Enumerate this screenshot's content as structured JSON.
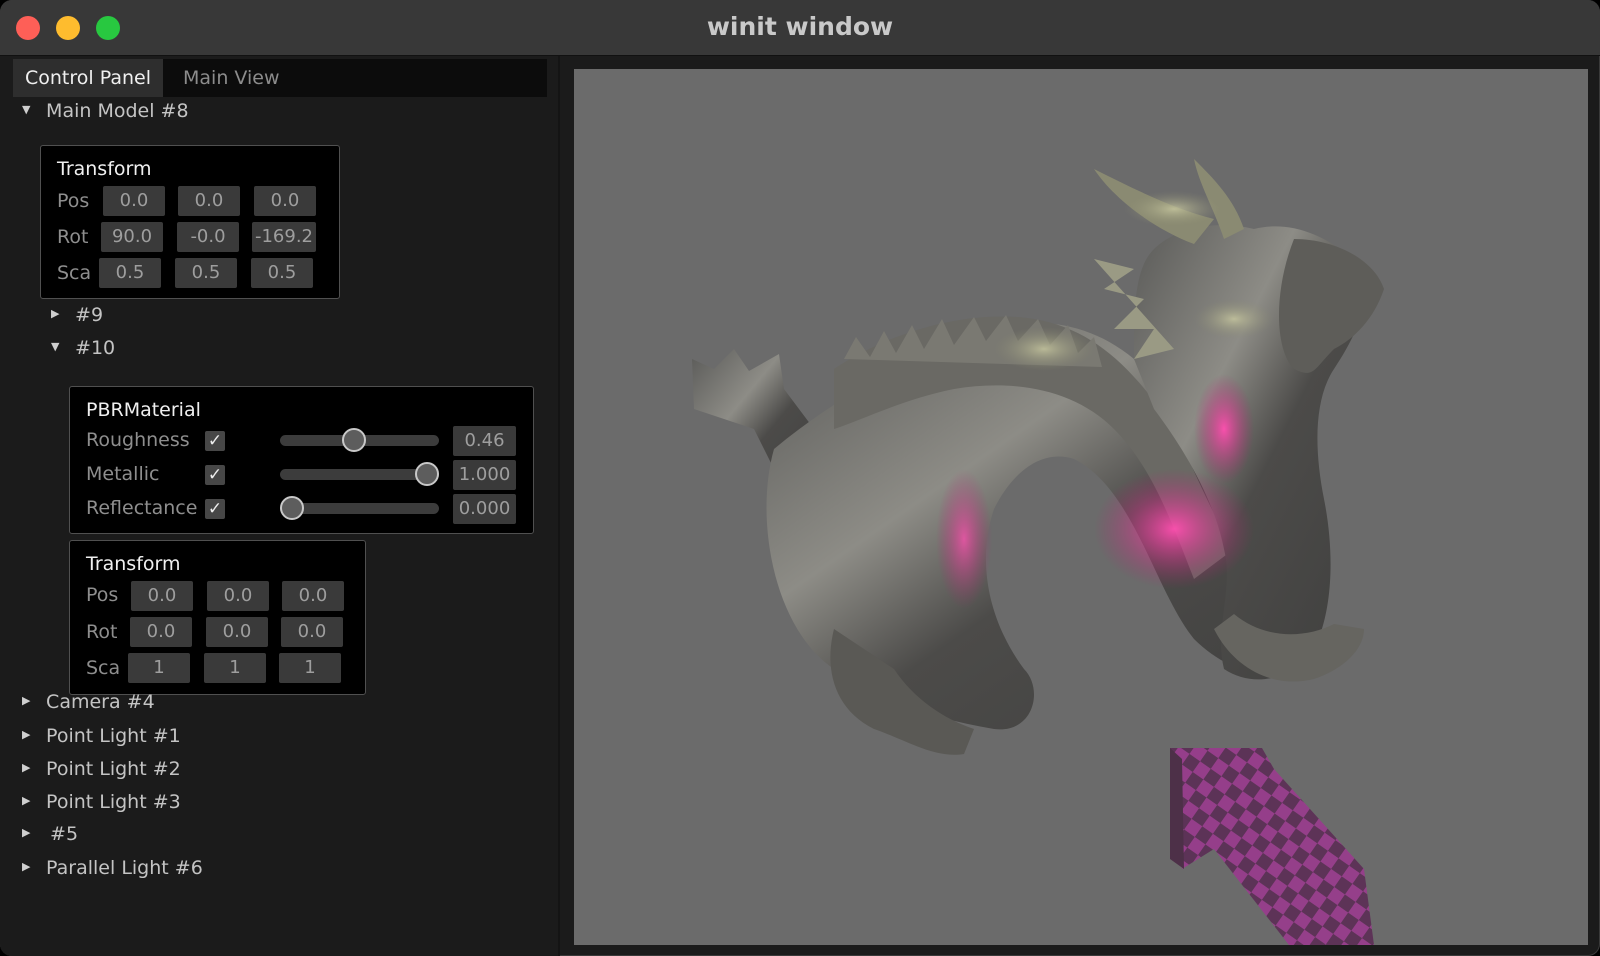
{
  "window": {
    "title": "winit window"
  },
  "tabs": [
    {
      "label": "Control Panel",
      "active": true
    },
    {
      "label": "Main View",
      "active": false
    }
  ],
  "tree": {
    "main_model": {
      "label": "Main Model #8",
      "expanded": true
    },
    "transform_top": {
      "title": "Transform",
      "pos_label": "Pos",
      "rot_label": "Rot",
      "sca_label": "Sca",
      "pos": [
        "0.0",
        "0.0",
        "0.0"
      ],
      "rot": [
        "90.0",
        "-0.0",
        "-169.2"
      ],
      "sca": [
        "0.5",
        "0.5",
        "0.5"
      ]
    },
    "child_9": {
      "label": "#9",
      "expanded": false
    },
    "child_10": {
      "label": "#10",
      "expanded": true
    },
    "material": {
      "title": "PBRMaterial",
      "rows": [
        {
          "label": "Roughness",
          "checked": true,
          "value": 0.46,
          "display": "0.46"
        },
        {
          "label": "Metallic",
          "checked": true,
          "value": 1.0,
          "display": "1.000"
        },
        {
          "label": "Reflectance",
          "checked": true,
          "value": 0.0,
          "display": "0.000"
        }
      ]
    },
    "transform_child": {
      "title": "Transform",
      "pos_label": "Pos",
      "rot_label": "Rot",
      "sca_label": "Sca",
      "pos": [
        "0.0",
        "0.0",
        "0.0"
      ],
      "rot": [
        "0.0",
        "0.0",
        "0.0"
      ],
      "sca": [
        "1",
        "1",
        "1"
      ]
    },
    "collapsed_nodes": [
      {
        "label": "Camera #4"
      },
      {
        "label": "Point Light #1"
      },
      {
        "label": "Point Light #2"
      },
      {
        "label": "Point Light #3"
      },
      {
        "label": "#5"
      },
      {
        "label": "Parallel Light #6"
      }
    ]
  },
  "icons": {
    "expanded": "▼",
    "collapsed": "▶",
    "check": "✓"
  },
  "colors": {
    "close": "#fe5f57",
    "minimize": "#febc2e",
    "maximize": "#28c840",
    "viewport_bg": "#6b6b6b",
    "highlight": "#e0308a"
  }
}
